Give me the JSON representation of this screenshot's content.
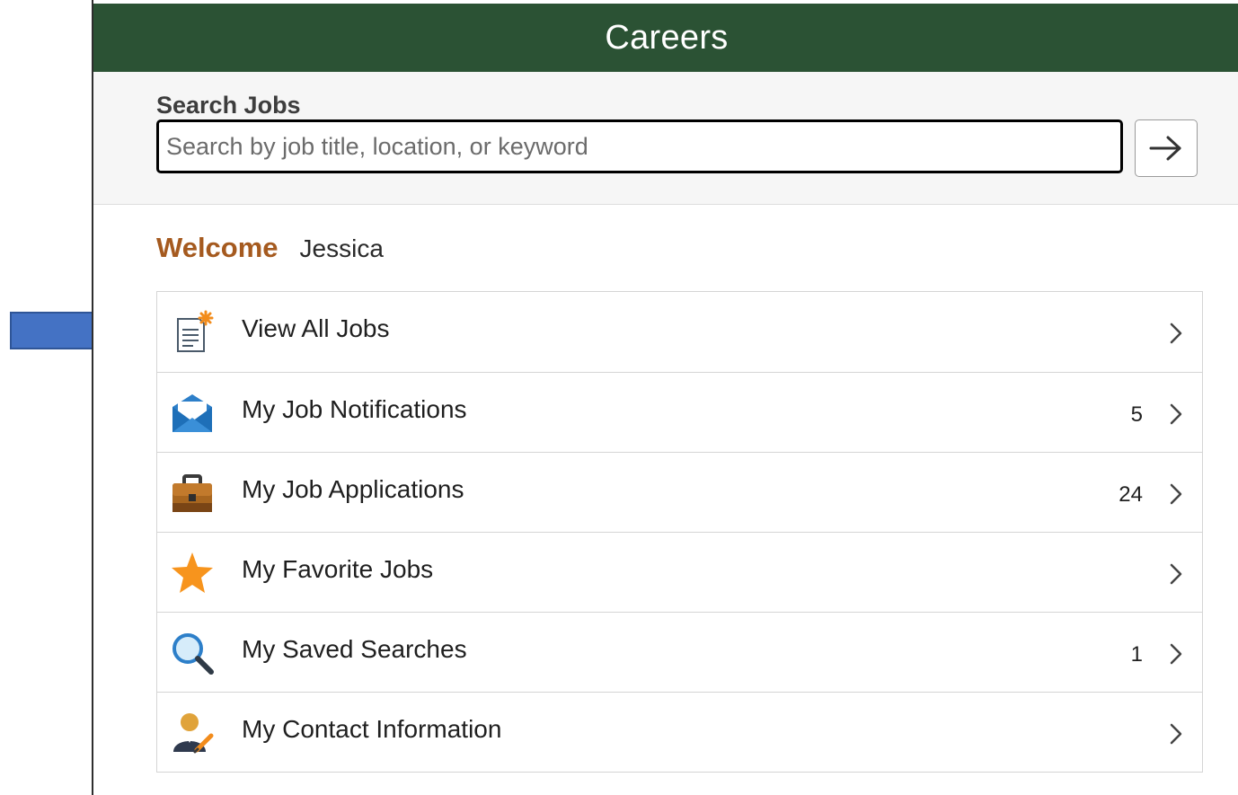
{
  "header": {
    "title": "Careers",
    "color": "#2b5234"
  },
  "search": {
    "label": "Search Jobs",
    "placeholder": "Search by job title, location, or keyword",
    "value": "",
    "go_icon": "arrow-right-icon"
  },
  "welcome": {
    "label": "Welcome",
    "name": "Jessica",
    "label_color": "#a55a1f"
  },
  "menu": {
    "items": [
      {
        "label": "View All Jobs",
        "count": "",
        "icon": "job-posting-icon"
      },
      {
        "label": "My Job Notifications",
        "count": "5",
        "icon": "envelope-icon"
      },
      {
        "label": "My Job Applications",
        "count": "24",
        "icon": "briefcase-icon"
      },
      {
        "label": "My Favorite Jobs",
        "count": "",
        "icon": "star-icon"
      },
      {
        "label": "My Saved Searches",
        "count": "1",
        "icon": "magnifier-icon"
      },
      {
        "label": "My Contact Information",
        "count": "",
        "icon": "contact-person-icon"
      }
    ]
  },
  "annotation": {
    "icon": "callout-arrow-icon",
    "color": "#4472c4"
  }
}
